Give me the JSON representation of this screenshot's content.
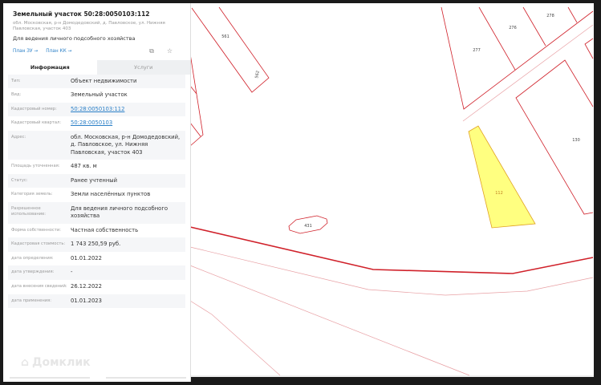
{
  "object": {
    "title": "Земельный участок 50:28:0050103:112",
    "address": "обл. Московская, р-н Домодедовский, д. Павловское, ул. Нижняя Павловская, участок 403",
    "purpose": "Для ведения личного подсобного хозяйства",
    "link_plan_zu": "План ЗУ →",
    "link_plan_kk": "План КК →"
  },
  "tabs": [
    "Информация",
    "Услуги"
  ],
  "rows": [
    {
      "label": "Тип:",
      "value": "Объект недвижимости"
    },
    {
      "label": "Вид:",
      "value": "Земельный участок"
    },
    {
      "label": "Кадастровый номер:",
      "value": "50:28:0050103:112",
      "link": true
    },
    {
      "label": "Кадастровый квартал:",
      "value": "50:28:0050103",
      "link": true
    },
    {
      "label": "Адрес:",
      "value": "обл. Московская, р-н Домодедовский, д. Павловское, ул. Нижняя Павловская, участок 403"
    },
    {
      "label": "Площадь уточненная:",
      "value": "487 кв. м"
    },
    {
      "label": "Статус:",
      "value": "Ранее учтенный"
    },
    {
      "label": "Категория земель:",
      "value": "Земли населённых пунктов"
    },
    {
      "label": "Разрешенное использование:",
      "value": "Для ведения личного подсобного хозяйства"
    },
    {
      "label": "Форма собственности:",
      "value": "Частная собственность"
    },
    {
      "label": "Кадастровая стоимость:",
      "value": "1 743 250,59 руб."
    },
    {
      "label": "дата определения:",
      "value": "01.01.2022"
    },
    {
      "label": "дата утверждения:",
      "value": "-"
    },
    {
      "label": "дата внесения сведений:",
      "value": "26.12.2022"
    },
    {
      "label": "дата применения:",
      "value": "01.01.2023"
    }
  ],
  "logo": "Домклик",
  "map": {
    "labels": {
      "p561": "561",
      "p562": "562",
      "p277": "277",
      "p276": "276",
      "p278": "278",
      "p130": "130",
      "p112": "112",
      "p431": "431"
    },
    "colors": {
      "boundary": "#d0212a",
      "light": "#e8a0a4",
      "selected": "#ffff80"
    }
  }
}
